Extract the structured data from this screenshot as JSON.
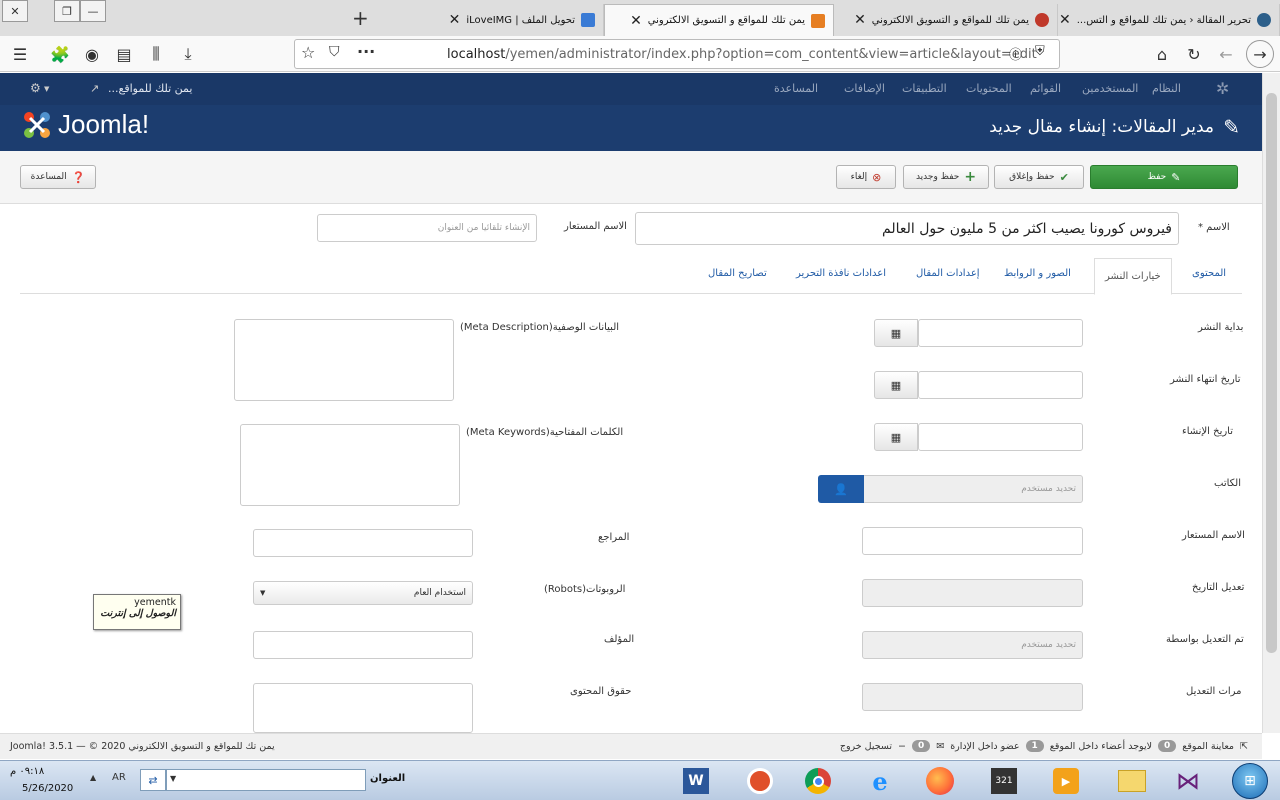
{
  "browser": {
    "tabs": [
      {
        "title": "تحرير المقالة ‹ يمن تلك للمواقع و التس...",
        "color": "#2c5f8a",
        "active": false
      },
      {
        "title": "يمن تلك للمواقع و التسويق الالكتروني",
        "color": "#c0392b",
        "active": false
      },
      {
        "title": "يمن تلك للمواقع و التسويق الالكتروني",
        "color": "#e67e22",
        "active": false
      },
      {
        "title": "يمن تلك للمواقع و التسويق الالكتروني",
        "color": "#e67e22",
        "active": true
      },
      {
        "title": "تحويل الملف | iLoveIMG",
        "color": "#3a7bd5",
        "active": false
      }
    ],
    "url_host": "localhost",
    "url_path": "/yemen/administrator/index.php?option=com_content&view=article&layout=edit",
    "icons": [
      "menu-icon",
      "extension-icon",
      "account-icon",
      "reader-icon",
      "library-icon",
      "download-icon",
      "star-icon",
      "pocket-icon",
      "more-icon",
      "info-icon",
      "shield-icon",
      "home-icon",
      "reload-icon",
      "back-icon",
      "forward-icon"
    ]
  },
  "admin_menu": {
    "items": [
      "النظام",
      "المستخدمين",
      "القوائم",
      "المحتويات",
      "التطبيقات",
      "الإضافات",
      "المساعدة"
    ],
    "site_link": "يمن تلك للمواقع...",
    "logo_text": "Joomla!",
    "page_title": "مدير المقالات: إنشاء مقال جديد"
  },
  "toolbar": {
    "save": "حفظ",
    "save_close": "حفظ وإغلاق",
    "save_new": "حفظ وجديد",
    "cancel": "إلغاء",
    "help": "المساعدة"
  },
  "title_row": {
    "title_label": "الاسم *",
    "title_value": "فيروس كورونا يصيب اكثر من 5 مليون حول العالم",
    "alias_label": "الاسم المستعار",
    "alias_placeholder": "الإنشاء تلقائيا من العنوان"
  },
  "form_tabs": [
    "المحتوى",
    "خيارات النشر",
    "الصور و الروابط",
    "إعدادات المقال",
    "اعدادات نافذة التحرير",
    "تصاريح المقال"
  ],
  "left_fields": {
    "publish_up": "بداية النشر",
    "publish_down": "تاريخ انتهاء النشر",
    "created": "تاريخ الإنشاء",
    "author": "الكاتب",
    "author_placeholder": "تحديد مستخدم",
    "created_by_alias": "الاسم المستعار",
    "modified": "تعديل التاريخ",
    "modified_by": "تم التعديل بواسطة",
    "modified_by_placeholder": "تحديد مستخدم",
    "revisions": "مرات التعديل"
  },
  "right_fields": {
    "meta_desc": "البيانات الوصفية(Meta Description)",
    "meta_keys": "الكلمات المفتاحية(Meta Keywords)",
    "reference": "المراجع",
    "robots": "الروبوتات(Robots)",
    "robots_value": "استخدام العام",
    "author": "المؤلف",
    "rights": "حقوق المحتوى"
  },
  "tooltip": {
    "line1": "yementk",
    "line2": "الوصول إلى إنترنت"
  },
  "footer": {
    "preview": "معاينة الموقع",
    "visitors_count": "0",
    "visitors": "لايوجد أعضاء داخل الموقع",
    "admins_count": "1",
    "admins": "عضو داخل الإدارة",
    "msgs_count": "0",
    "logout": "تسجيل خروج",
    "copyright": "يمن تك للمواقع و التسويق الالكتروني Joomla! 3.5.1 — © 2020"
  },
  "taskbar": {
    "address_label": "العنوان",
    "lang": "AR",
    "time": "٠٩:١٨ م",
    "date": "5/26/2020"
  }
}
